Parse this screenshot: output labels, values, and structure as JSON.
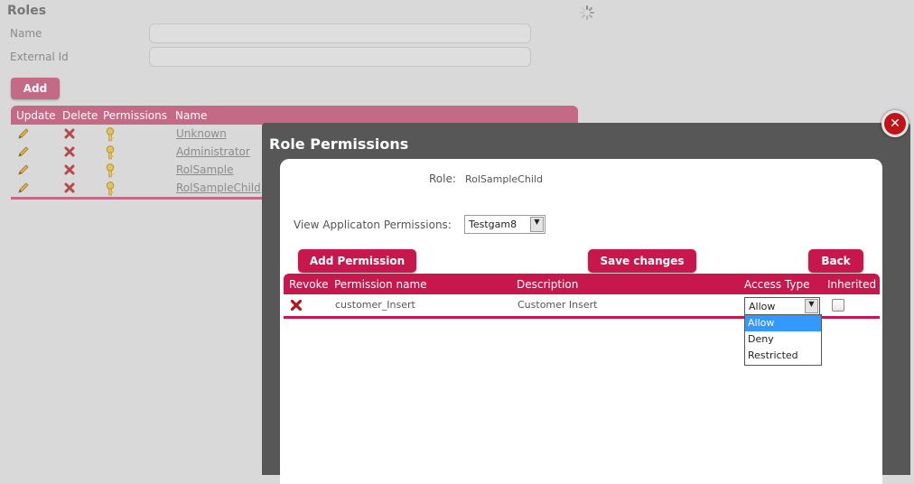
{
  "roles": {
    "title": "Roles",
    "name_label": "Name",
    "external_id_label": "External Id",
    "add_button": "Add",
    "columns": [
      "Update",
      "Delete",
      "Permissions",
      "Name"
    ],
    "rows": [
      "Unknown",
      "Administrator",
      "RolSample",
      "RolSampleChild"
    ]
  },
  "modal": {
    "title": "Role Permissions",
    "close_icon": "close-icon",
    "role_label": "Role:",
    "role_value": "RolSampleChild",
    "view_label": "View Applicaton Permissions:",
    "application_selected": "Testgam8",
    "add_permission_button": "Add Permission",
    "save_changes_button": "Save changes",
    "back_button": "Back",
    "columns": {
      "revoke": "Revoke",
      "permission_name": "Permission name",
      "description": "Description",
      "access_type": "Access Type",
      "inherited": "Inherited"
    },
    "permission_row": {
      "name": "customer_Insert",
      "description": "Customer Insert",
      "access_type": "Allow",
      "inherited": false
    },
    "access_type_options": [
      "Allow",
      "Deny",
      "Restricted"
    ],
    "highlighted_option": "Allow"
  },
  "colors": {
    "accent": "#c8174c",
    "muted_accent": "#c46a87",
    "modal_bg": "#575757",
    "option_highlight": "#3399ff"
  }
}
